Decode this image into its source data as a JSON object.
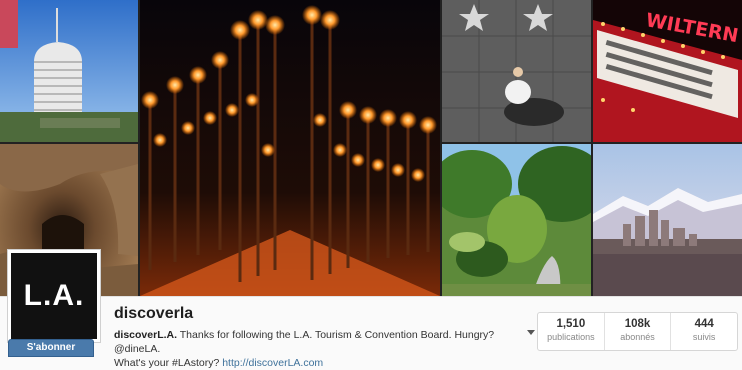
{
  "profile": {
    "avatar_text": "L.A.",
    "follow_label": "S'abonner",
    "username": "discoverla",
    "bio": {
      "name": "discoverL.A.",
      "text_1": " Thanks for following the L.A. Tourism & Convention Board. Hungry? @dineLA.",
      "text_2": "What's your #LAstory? ",
      "link": "http://discoverLA.com"
    }
  },
  "stats": [
    {
      "value": "1,510",
      "label": "publications"
    },
    {
      "value": "108k",
      "label": "abonnés"
    },
    {
      "value": "444",
      "label": "suivis"
    }
  ],
  "photos": {
    "marquee_text": "WILTERN"
  },
  "colors": {
    "follow_button": "#4a7aab",
    "link": "#3f729b"
  }
}
